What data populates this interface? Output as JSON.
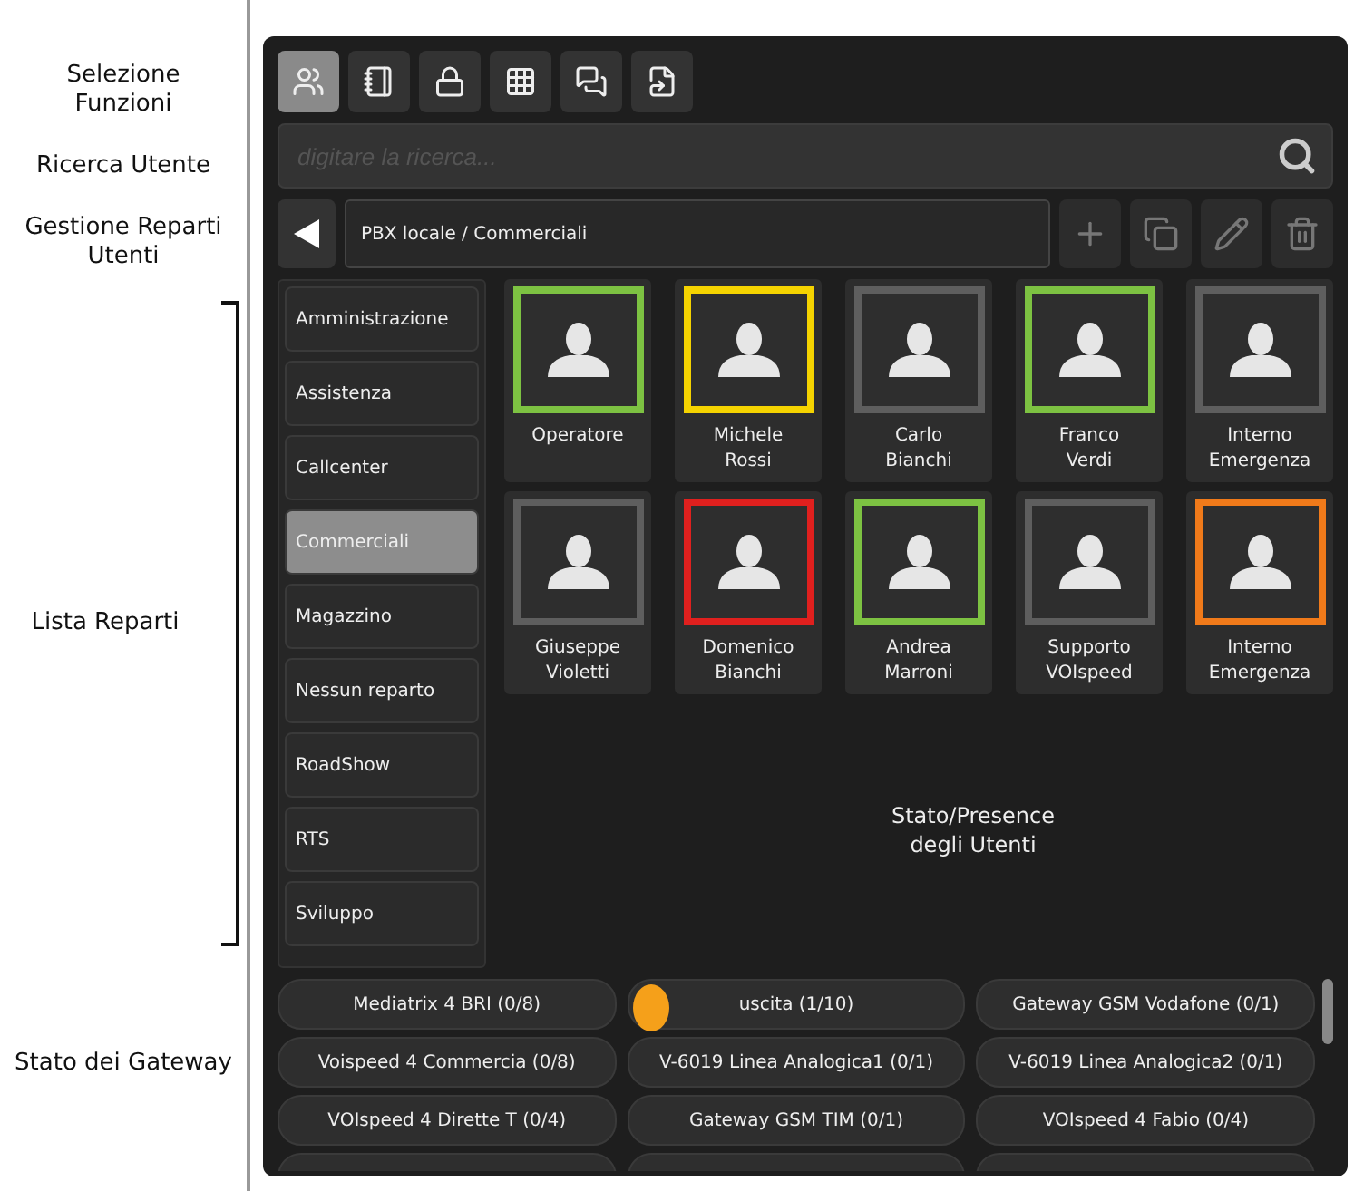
{
  "annotations": {
    "functions": "Selezione Funzioni",
    "search": "Ricerca Utente",
    "departments_management": "Gestione Reparti Utenti",
    "department_list": "Lista Reparti",
    "gateways": "Stato dei Gateway",
    "presence": "Stato/Presence degli Utenti"
  },
  "toolbar": [
    {
      "kind": "users",
      "selected": true
    },
    {
      "kind": "notebook",
      "selected": false
    },
    {
      "kind": "lock",
      "selected": false
    },
    {
      "kind": "grid",
      "selected": false
    },
    {
      "kind": "chat",
      "selected": false
    },
    {
      "kind": "transfer",
      "selected": false
    }
  ],
  "search": {
    "placeholder": "digitare la ricerca..."
  },
  "breadcrumb": {
    "path": "PBX locale / Commerciali"
  },
  "actions": [
    {
      "kind": "add"
    },
    {
      "kind": "copy"
    },
    {
      "kind": "edit"
    },
    {
      "kind": "delete"
    }
  ],
  "departments": [
    {
      "label": "Amministrazione",
      "selected": false
    },
    {
      "label": "Assistenza",
      "selected": false
    },
    {
      "label": "Callcenter",
      "selected": false
    },
    {
      "label": "Commerciali",
      "selected": true
    },
    {
      "label": "Magazzino",
      "selected": false
    },
    {
      "label": "Nessun reparto",
      "selected": false
    },
    {
      "label": "RoadShow",
      "selected": false
    },
    {
      "label": "RTS",
      "selected": false
    },
    {
      "label": "Sviluppo",
      "selected": false
    }
  ],
  "users": [
    {
      "first": "Operatore",
      "color": "#7dc242"
    },
    {
      "first": "Michele",
      "last": "Rossi",
      "color": "#f5d300"
    },
    {
      "first": "Carlo",
      "last": "Bianchi",
      "color": "#5e5e5e"
    },
    {
      "first": "Franco",
      "last": "Verdi",
      "color": "#7dc242"
    },
    {
      "first": "Interno",
      "last": "Emergenza",
      "color": "#5e5e5e"
    },
    {
      "first": "Giuseppe",
      "last": "Violetti",
      "color": "#5e5e5e"
    },
    {
      "first": "Domenico",
      "last": "Bianchi",
      "color": "#e0201e"
    },
    {
      "first": "Andrea",
      "last": "Marroni",
      "color": "#7dc242"
    },
    {
      "first": "Supporto",
      "last": "VOIspeed",
      "color": "#5e5e5e"
    },
    {
      "first": "Interno",
      "last": "Emergenza",
      "color": "#f07a1a"
    }
  ],
  "gateways": [
    {
      "label": "Mediatrix 4 BRI (0/8)"
    },
    {
      "label": "uscita (1/10)",
      "color": "#f5a01a"
    },
    {
      "label": "Gateway GSM Vodafone (0/1)"
    },
    {
      "label": "Voispeed 4 Commercia (0/8)"
    },
    {
      "label": "V-6019 Linea Analogica1 (0/1)"
    },
    {
      "label": "V-6019 Linea Analogica2 (0/1)"
    },
    {
      "label": "VOIspeed 4 Dirette T (0/4)"
    },
    {
      "label": "Gateway GSM TIM (0/1)"
    },
    {
      "label": "VOIspeed 4 Fabio (0/4)"
    }
  ]
}
